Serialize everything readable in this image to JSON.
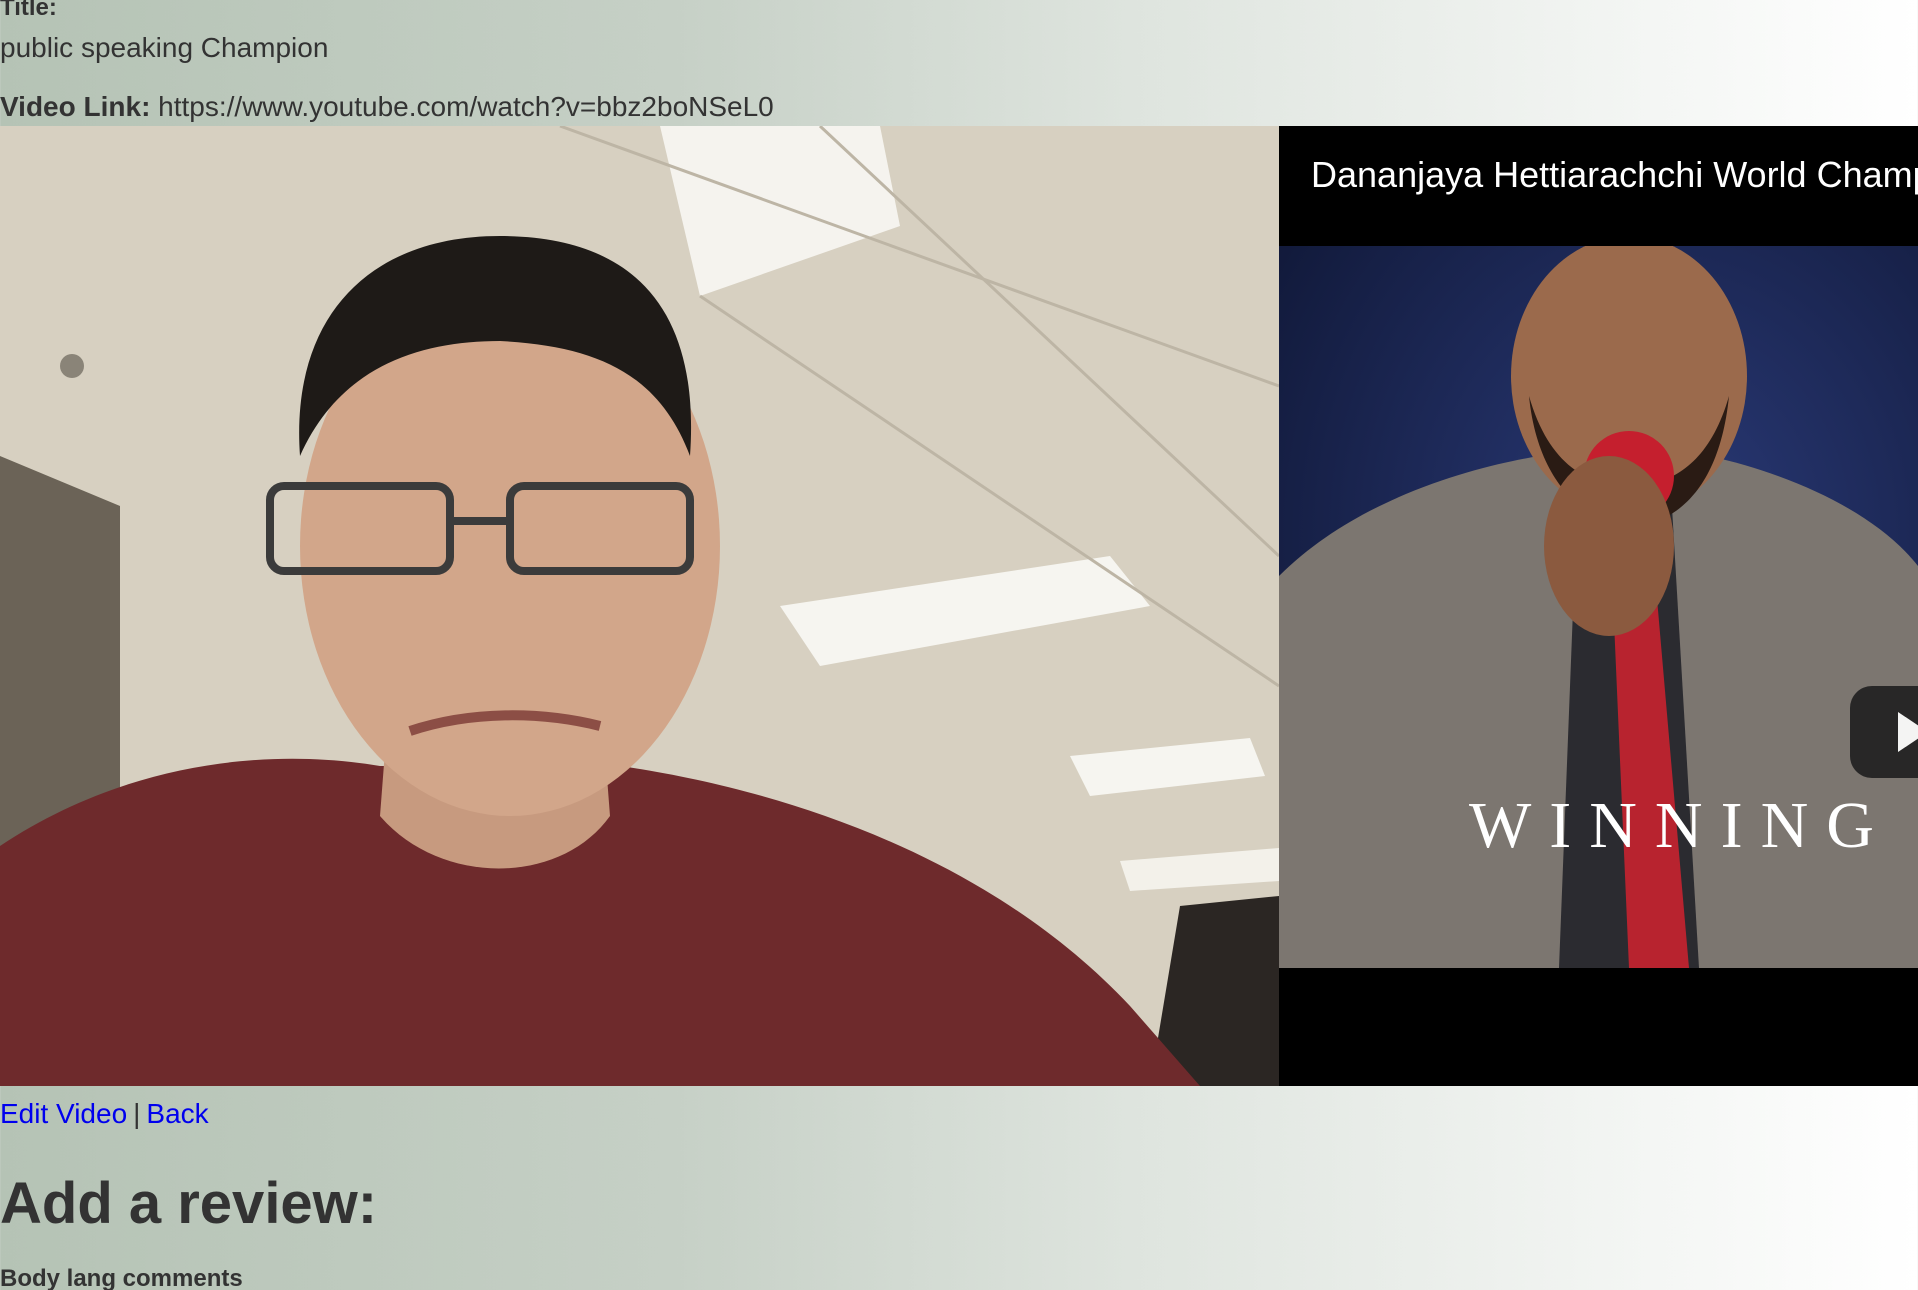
{
  "fields": {
    "title_label": "Title:",
    "title_value": "public speaking Champion",
    "video_link_label": "Video Link:",
    "video_link_value": "https://www.youtube.com/watch?v=bbz2boNSeL0"
  },
  "webcam": {
    "icon": "webcam-feed"
  },
  "youtube": {
    "title": "Dananjaya Hettiarachchi World Champ",
    "overlay_text": "WINNING",
    "play_icon": "play-icon"
  },
  "links": {
    "edit_label": "Edit Video",
    "separator": "|",
    "back_label": "Back"
  },
  "review": {
    "heading": "Add a review:",
    "body_lang_label": "Body lang comments"
  },
  "colors": {
    "link": "#0000ee",
    "text": "#333333",
    "shirt": "#6e2a2c",
    "yt_background": "#000000"
  }
}
